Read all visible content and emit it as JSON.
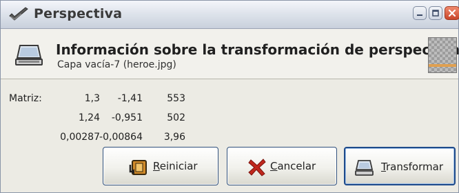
{
  "window": {
    "title": "Perspectiva",
    "controls": [
      "minimize",
      "maximize",
      "close"
    ]
  },
  "header": {
    "title": "Información sobre la transformación de perspectiva",
    "subtitle": "Capa vacía-7 (heroe.jpg)"
  },
  "matrix": {
    "label": "Matriz:",
    "rows": [
      [
        "1,3",
        "-1,41",
        "553"
      ],
      [
        "1,24",
        "-0,951",
        "502"
      ],
      [
        "0,00287",
        "-0,00864",
        "3,96"
      ]
    ]
  },
  "buttons": {
    "reset": {
      "mnemonic": "R",
      "rest": "einiciar"
    },
    "cancel": {
      "mnemonic": "C",
      "rest": "ancelar"
    },
    "transform": {
      "mnemonic": "T",
      "rest": "ransformar"
    }
  },
  "colors": {
    "default_button_border": "#1e4a8a",
    "cancel_icon": "#c0281e"
  }
}
